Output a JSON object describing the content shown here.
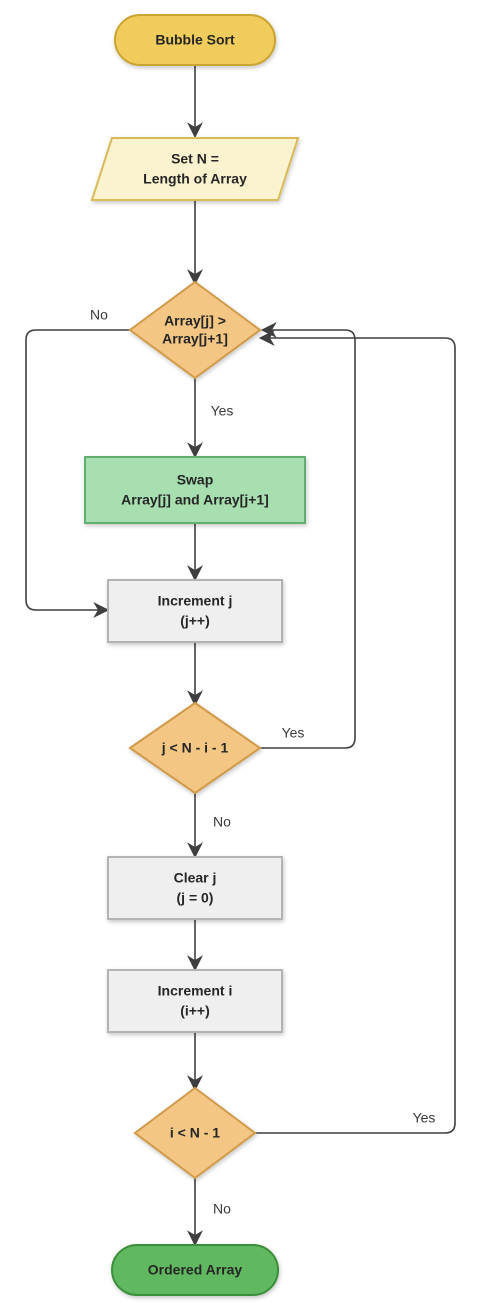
{
  "chart_data": {
    "type": "flowchart",
    "title": "Bubble Sort",
    "nodes": [
      {
        "id": "start",
        "shape": "terminator",
        "label": "Bubble Sort"
      },
      {
        "id": "setn",
        "shape": "io",
        "label_l1": "Set N =",
        "label_l2": "Length of Array"
      },
      {
        "id": "cmp",
        "shape": "decision",
        "label_l1": "Array[j] >",
        "label_l2": "Array[j+1]"
      },
      {
        "id": "swap",
        "shape": "process_green",
        "label_l1": "Swap",
        "label_l2": "Array[j] and Array[j+1]"
      },
      {
        "id": "incj",
        "shape": "process_gray",
        "label_l1": "Increment j",
        "label_l2": "(j++)"
      },
      {
        "id": "jcond",
        "shape": "decision",
        "label_l1": "j < N - i - 1"
      },
      {
        "id": "clearj",
        "shape": "process_gray",
        "label_l1": "Clear j",
        "label_l2": "(j = 0)"
      },
      {
        "id": "inci",
        "shape": "process_gray",
        "label_l1": "Increment i",
        "label_l2": "(i++)"
      },
      {
        "id": "icond",
        "shape": "decision",
        "label_l1": "i < N - 1"
      },
      {
        "id": "end",
        "shape": "terminator_end",
        "label": "Ordered Array"
      }
    ],
    "edges": [
      {
        "from": "start",
        "to": "setn"
      },
      {
        "from": "setn",
        "to": "cmp"
      },
      {
        "from": "cmp",
        "to": "swap",
        "label": "Yes"
      },
      {
        "from": "cmp",
        "to": "incj",
        "label": "No"
      },
      {
        "from": "swap",
        "to": "incj"
      },
      {
        "from": "incj",
        "to": "jcond"
      },
      {
        "from": "jcond",
        "to": "cmp",
        "label": "Yes"
      },
      {
        "from": "jcond",
        "to": "clearj",
        "label": "No"
      },
      {
        "from": "clearj",
        "to": "inci"
      },
      {
        "from": "inci",
        "to": "icond"
      },
      {
        "from": "icond",
        "to": "cmp",
        "label": "Yes"
      },
      {
        "from": "icond",
        "to": "end",
        "label": "No"
      }
    ]
  },
  "labels": {
    "start": "Bubble Sort",
    "setn_l1": "Set N =",
    "setn_l2": "Length of Array",
    "cmp_l1": "Array[j] >",
    "cmp_l2": "Array[j+1]",
    "cmp_yes": "Yes",
    "cmp_no": "No",
    "swap_l1": "Swap",
    "swap_l2": "Array[j] and Array[j+1]",
    "incj_l1": "Increment j",
    "incj_l2": "(j++)",
    "jcond_l1": "j < N - i - 1",
    "jcond_yes": "Yes",
    "jcond_no": "No",
    "clearj_l1": "Clear j",
    "clearj_l2": "(j = 0)",
    "inci_l1": "Increment i",
    "inci_l2": "(i++)",
    "icond_l1": "i < N - 1",
    "icond_yes": "Yes",
    "icond_no": "No",
    "end": "Ordered Array"
  },
  "colors": {
    "terminator_start_fill": "#f0cc5b",
    "terminator_start_stroke": "#caa432",
    "terminator_end_fill": "#60b860",
    "terminator_end_stroke": "#3a8e3a",
    "io_fill": "#fbf3cf",
    "io_stroke": "#d8ba56",
    "decision_fill": "#f3c684",
    "decision_stroke": "#d09a4a",
    "process_green_fill": "#a7dfb0",
    "process_green_stroke": "#63ad6e",
    "process_gray_fill": "#efefef",
    "process_gray_stroke": "#b3b3b3",
    "arrow": "#3f3f3f"
  }
}
